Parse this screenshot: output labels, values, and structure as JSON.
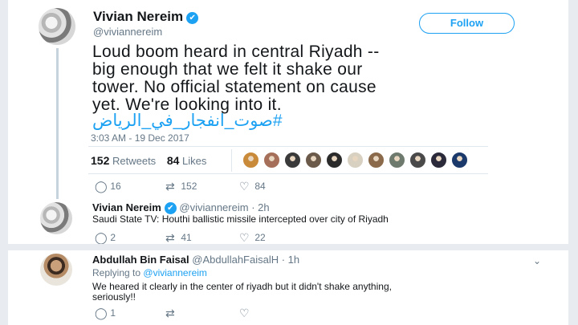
{
  "main_tweet": {
    "display_name": "Vivian Nereim",
    "handle": "@viviannereim",
    "follow_label": "Follow",
    "text_lines": [
      "Loud boom heard in central Riyadh --",
      "big enough that we felt it shake our",
      "tower. No official statement on cause",
      "yet. We're looking into it."
    ],
    "hashtag": "#صوت_انفجار_في_الرياض",
    "timestamp": "3:03 AM - 19 Dec 2017",
    "retweets_count": "152",
    "retweets_label": "Retweets",
    "likes_count": "84",
    "likes_label": "Likes",
    "liker_colors": [
      "#c98a3a",
      "#a66f5a",
      "#3a3a3a",
      "#6b5a4a",
      "#2b2b2b",
      "#d8d0c0",
      "#8a6a4a",
      "#6e7a6e",
      "#4a4a4a",
      "#2a2a3a",
      "#1b3a6b"
    ],
    "actions": {
      "reply_count": "16",
      "retweet_count": "152",
      "like_count": "84"
    }
  },
  "replies": [
    {
      "display_name": "Vivian Nereim",
      "handle": "@viviannereim",
      "age": "· 2h",
      "text": "Saudi State TV: Houthi ballistic missile intercepted over city of Riyadh",
      "reply_count": "2",
      "retweet_count": "41",
      "like_count": "22"
    },
    {
      "display_name": "Abdullah Bin Faisal",
      "handle": "@AbdullahFaisalH",
      "age": "· 1h",
      "replying_prefix": "Replying to",
      "replying_to": "@viviannereim",
      "text_line1": "We heared it clearly in the center of riyadh but it didn't shake anything,",
      "text_line2": "seriously!!",
      "reply_count": "1",
      "retweet_count": "",
      "like_count": ""
    }
  ],
  "icons": {
    "verified": "✔",
    "reply": "💬",
    "retweet": "⇄",
    "like": "♡",
    "caret": "⌄"
  }
}
